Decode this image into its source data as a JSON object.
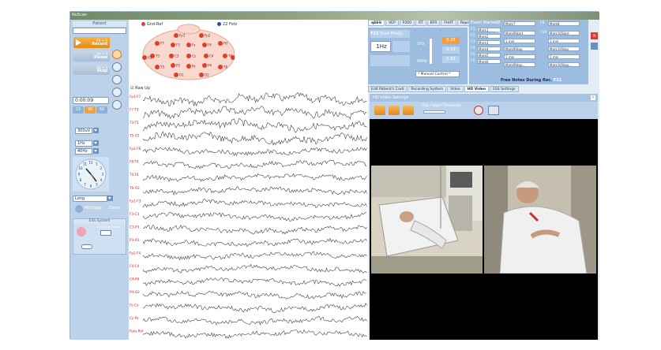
{
  "window": {
    "title": "NuScan"
  },
  "left": {
    "patient_label": "Patient",
    "record": {
      "label": "Record",
      "hint": "Alt + R"
    },
    "pause": {
      "label": "Pause",
      "hint": "Alt + P"
    },
    "stop": {
      "label": "Stop",
      "hint": "Alt + S"
    },
    "timer": "0:00:09",
    "speed": {
      "slow": "15",
      "current": "30",
      "fast": "60"
    },
    "sensitivity": "300uV",
    "low_filter": "1Hz",
    "high_filter": "40Hz",
    "montage_select": "Long",
    "montage_button": "Montage",
    "zoom_button": "Zoom",
    "ess_label": "ESS System",
    "hard_disk": "Hard Disk Space",
    "clock": {
      "hour_text": [
        "12",
        "1",
        "2",
        "3",
        "4",
        "5",
        "6",
        "7",
        "8",
        "9",
        "10",
        "11"
      ]
    }
  },
  "eeg": {
    "legend_ref": "Gnd-Ref",
    "legend_fz": "22 Fotz",
    "raw_checkbox": "Raw Up",
    "electrodes": [
      "Fp1",
      "Fp2",
      "F7",
      "F3",
      "Fz",
      "F4",
      "F8",
      "T3",
      "C3",
      "Cz",
      "C4",
      "T4",
      "T5",
      "P3",
      "Pz",
      "P4",
      "T6",
      "O1",
      "O2",
      "A1",
      "A2"
    ],
    "channels": [
      "Fp1-F7",
      "F7-T3",
      "T3-T5",
      "T5-O1",
      "Fp2-F8",
      "F8-T4",
      "T4-T6",
      "T6-O2",
      "Fp1-F3",
      "F3-C3",
      "C3-P3",
      "P3-O1",
      "Fp2-F4",
      "F4-C4",
      "C4-P4",
      "P4-O2",
      "Fz-Cz",
      "Cz-Pz",
      "Foto-Ref"
    ]
  },
  "right": {
    "top_tabs": [
      "qEEG",
      "VEP",
      "P300",
      "RT",
      "BFR",
      "FHAT",
      "Reps."
    ],
    "photic": {
      "key": "F12",
      "label": "Start Photic",
      "freq": "1Hz",
      "freq_label": "1Hz",
      "freq_high": "60Hz",
      "mode": "* Manual Control *",
      "values": [
        "0.33",
        "0.53",
        "1.83"
      ]
    },
    "markers_title": "Event Markers",
    "markers": [
      {
        "key": "F1",
        "label": "Mark1"
      },
      {
        "key": "F2",
        "label": "Mark2"
      },
      {
        "key": "F3",
        "label": "Mark3"
      },
      {
        "key": "F4",
        "label": "Mark4"
      },
      {
        "key": "F5",
        "label": "Mark5"
      },
      {
        "key": "F6",
        "label": "Mark6"
      },
      {
        "key": "F7",
        "label": "Mark7"
      },
      {
        "key": "F8",
        "label": "Mark8"
      },
      {
        "key": "F9",
        "label": "Mark9Start"
      },
      {
        "key": "F10",
        "label": "Mark10Start"
      }
    ],
    "marker_opts": [
      "1 min",
      "Mark9Stop",
      "1 min",
      "Mark9Stop...",
      "1 min",
      "Mark10Stop",
      "1 min",
      "Mark10Stop..."
    ],
    "free_notes": "Free Notes During Rec.",
    "free_notes_key": "F11",
    "lower_tabs": [
      "Edit Patient's Card",
      "Recording System",
      "Video",
      "HD Video",
      "ESS Settings"
    ],
    "hd_title": "HD Video Settings",
    "day_night_label": "Day / Night Threshold"
  },
  "colors": {
    "accent": "#e48a16",
    "panel": "#bcd2ea",
    "trace": "#333333",
    "label": "#d02020"
  }
}
